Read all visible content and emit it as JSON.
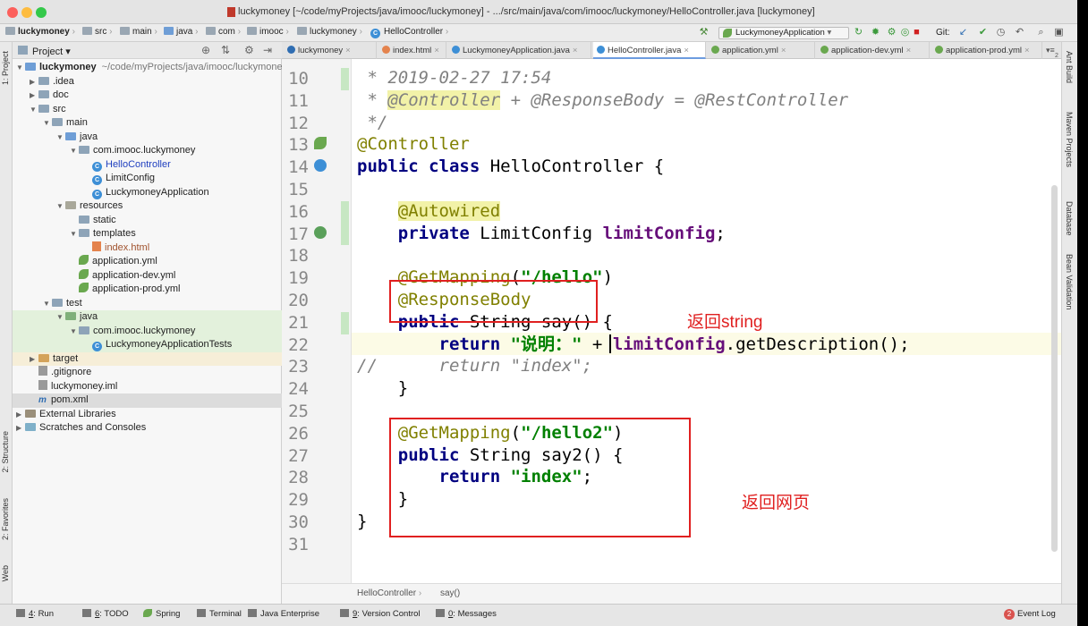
{
  "window": {
    "title": "luckymoney [~/code/myProjects/java/imooc/luckymoney] - .../src/main/java/com/imooc/luckymoney/HelloController.java [luckymoney]"
  },
  "navbar": {
    "crumbs": [
      "luckymoney",
      "src",
      "main",
      "java",
      "com",
      "imooc",
      "luckymoney",
      "HelloController"
    ],
    "run_config": "LuckymoneyApplication",
    "git_label": "Git:"
  },
  "project": {
    "header": "Project",
    "tree": [
      {
        "label": "luckymoney",
        "path": "~/code/myProjects/java/imooc/luckymoney",
        "indent": 0,
        "arrow": "▼",
        "icon": "module",
        "bold": true
      },
      {
        "label": ".idea",
        "indent": 1,
        "arrow": "▶",
        "icon": "folder"
      },
      {
        "label": "doc",
        "indent": 1,
        "arrow": "▶",
        "icon": "folder"
      },
      {
        "label": "src",
        "indent": 1,
        "arrow": "▼",
        "icon": "folder"
      },
      {
        "label": "main",
        "indent": 2,
        "arrow": "▼",
        "icon": "folder"
      },
      {
        "label": "java",
        "indent": 3,
        "arrow": "▼",
        "icon": "src"
      },
      {
        "label": "com.imooc.luckymoney",
        "indent": 4,
        "arrow": "▼",
        "icon": "folder"
      },
      {
        "label": "HelloController",
        "indent": 5,
        "arrow": "",
        "icon": "class",
        "color": "#1f3fbf"
      },
      {
        "label": "LimitConfig",
        "indent": 5,
        "arrow": "",
        "icon": "class"
      },
      {
        "label": "LuckymoneyApplication",
        "indent": 5,
        "arrow": "",
        "icon": "class"
      },
      {
        "label": "resources",
        "indent": 3,
        "arrow": "▼",
        "icon": "res"
      },
      {
        "label": "static",
        "indent": 4,
        "arrow": "",
        "icon": "folder"
      },
      {
        "label": "templates",
        "indent": 4,
        "arrow": "▼",
        "icon": "folder"
      },
      {
        "label": "index.html",
        "indent": 5,
        "arrow": "",
        "icon": "html",
        "color": "#a0522d"
      },
      {
        "label": "application.yml",
        "indent": 4,
        "arrow": "",
        "icon": "spring"
      },
      {
        "label": "application-dev.yml",
        "indent": 4,
        "arrow": "",
        "icon": "spring"
      },
      {
        "label": "application-prod.yml",
        "indent": 4,
        "arrow": "",
        "icon": "spring"
      },
      {
        "label": "test",
        "indent": 2,
        "arrow": "▼",
        "icon": "folder"
      },
      {
        "label": "java",
        "indent": 3,
        "arrow": "▼",
        "icon": "test",
        "bg": "#e3f1dc"
      },
      {
        "label": "com.imooc.luckymoney",
        "indent": 4,
        "arrow": "▼",
        "icon": "folder",
        "bg": "#e3f1dc"
      },
      {
        "label": "LuckymoneyApplicationTests",
        "indent": 5,
        "arrow": "",
        "icon": "class",
        "bg": "#e3f1dc"
      },
      {
        "label": "target",
        "indent": 1,
        "arrow": "▶",
        "icon": "target",
        "bg": "#f6eed8"
      },
      {
        "label": ".gitignore",
        "indent": 1,
        "arrow": "",
        "icon": "file"
      },
      {
        "label": "luckymoney.iml",
        "indent": 1,
        "arrow": "",
        "icon": "file"
      },
      {
        "label": "pom.xml",
        "indent": 1,
        "arrow": "",
        "icon": "maven",
        "bg": "#dcdcdc"
      },
      {
        "label": "External Libraries",
        "indent": 0,
        "arrow": "▶",
        "icon": "lib"
      },
      {
        "label": "Scratches and Consoles",
        "indent": 0,
        "arrow": "▶",
        "icon": "scratch"
      }
    ]
  },
  "tabs": [
    {
      "label": "luckymoney",
      "color": "#2f6db2"
    },
    {
      "label": "index.html",
      "color": "#e4834d"
    },
    {
      "label": "LuckymoneyApplication.java",
      "color": "#3d8fd6"
    },
    {
      "label": "HelloController.java",
      "color": "#3d8fd6",
      "active": true
    },
    {
      "label": "application.yml",
      "color": "#6aa84f"
    },
    {
      "label": "application-dev.yml",
      "color": "#6aa84f"
    },
    {
      "label": "application-prod.yml",
      "color": "#6aa84f"
    }
  ],
  "tabs_overflow": "2",
  "editor": {
    "first_line": 10,
    "lines": [
      [
        [
          "cm",
          " * 2019-02-27 17:54"
        ]
      ],
      [
        [
          "cm",
          " * "
        ],
        [
          "cm hlan",
          "@Controller"
        ],
        [
          "cm",
          " + @ResponseBody = @RestController"
        ]
      ],
      [
        [
          "cm",
          " */"
        ]
      ],
      [
        [
          "an",
          "@Controller"
        ]
      ],
      [
        [
          "kw",
          "public class "
        ],
        [
          "",
          "HelloController {"
        ]
      ],
      [],
      [
        [
          "",
          "    "
        ],
        [
          "an hlan",
          "@Autowired"
        ]
      ],
      [
        [
          "kw",
          "    private "
        ],
        [
          "",
          "LimitConfig "
        ],
        [
          "fld",
          "limitConfig"
        ],
        [
          "",
          ";"
        ]
      ],
      [],
      [
        [
          "",
          "    "
        ],
        [
          "an",
          "@GetMapping"
        ],
        [
          "",
          "("
        ],
        [
          "str",
          "\"/hello\""
        ],
        [
          "",
          ")"
        ]
      ],
      [
        [
          "",
          "    "
        ],
        [
          "an",
          "@ResponseBody"
        ]
      ],
      [
        [
          "kw",
          "    public "
        ],
        [
          "",
          "String say() {"
        ]
      ],
      [
        [
          "kw",
          "        return "
        ],
        [
          "str",
          "\"说明：\""
        ],
        [
          "",
          " + "
        ],
        [
          "fld",
          "limitConfig"
        ],
        [
          "",
          ".getDescription();"
        ]
      ],
      [
        [
          "cm",
          "//      return \"index\";"
        ]
      ],
      [
        [
          "",
          "    }"
        ]
      ],
      [],
      [
        [
          "",
          "    "
        ],
        [
          "an",
          "@GetMapping"
        ],
        [
          "",
          "("
        ],
        [
          "str",
          "\"/hello2\""
        ],
        [
          "",
          ")"
        ]
      ],
      [
        [
          "kw",
          "    public "
        ],
        [
          "",
          "String say2() {"
        ]
      ],
      [
        [
          "kw",
          "        return "
        ],
        [
          "str",
          "\"index\""
        ],
        [
          "",
          ";"
        ]
      ],
      [
        [
          "",
          "    }"
        ]
      ],
      [
        [
          "",
          "}"
        ]
      ],
      []
    ]
  },
  "editor_breadcrumb": [
    "HelloController",
    "say()"
  ],
  "annotations": {
    "note1": "返回string",
    "note2": "返回网页"
  },
  "right_tools": [
    "Ant Build",
    "Maven Projects",
    "Database",
    "Bean Validation"
  ],
  "left_tools": [
    "1: Project",
    "2: Structure",
    "2: Favorites",
    "Web"
  ],
  "status": {
    "items": [
      {
        "key": "4",
        "label": ": Run"
      },
      {
        "key": "6",
        "label": ": TODO"
      },
      {
        "key": "",
        "label": "Spring"
      },
      {
        "key": "",
        "label": "Terminal"
      },
      {
        "key": "",
        "label": "Java Enterprise"
      },
      {
        "key": "9",
        "label": ": Version Control"
      },
      {
        "key": "0",
        "label": ": Messages"
      }
    ],
    "event_log": "Event Log",
    "event_count": "2"
  },
  "colors": {
    "annotation_red": "#e02020",
    "keyword": "#000080",
    "annotation": "#808000",
    "string": "#008000"
  }
}
